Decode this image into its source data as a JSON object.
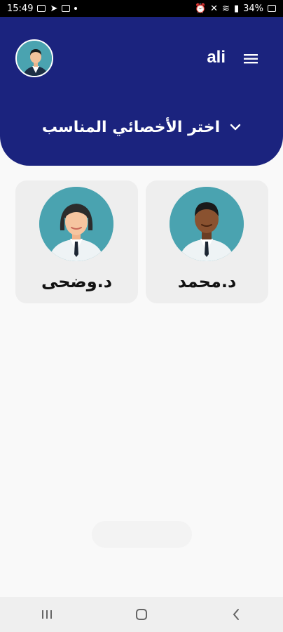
{
  "status_bar": {
    "time": "15:49",
    "battery": "34%"
  },
  "header": {
    "username": "ali",
    "specialist_selector_label": "اختر الأخصائي المناسب"
  },
  "doctors": [
    {
      "name": "د.محمد",
      "avatar": "male-doctor-avatar"
    },
    {
      "name": "د.وضحى",
      "avatar": "female-doctor-avatar"
    }
  ],
  "colors": {
    "header_bg": "#1b237e",
    "avatar_bg": "#4aa3b0",
    "card_bg": "#eeeeee",
    "page_bg": "#f9f9f9"
  }
}
